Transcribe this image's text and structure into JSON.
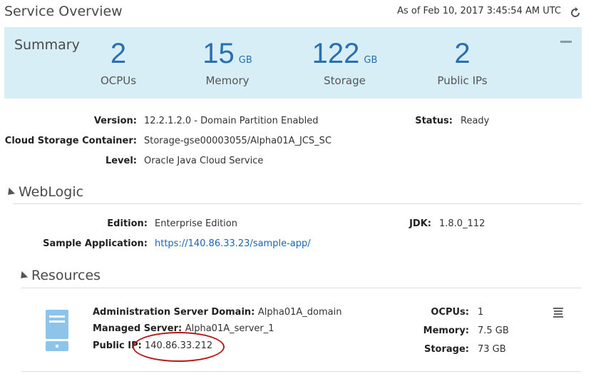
{
  "header": {
    "title": "Service Overview",
    "timestamp": "As of Feb 10, 2017 3:45:54 AM UTC",
    "refresh_icon": "refresh-icon"
  },
  "summary": {
    "title": "Summary",
    "collapse_icon": "minus-icon",
    "ocpus": {
      "value": "2",
      "unit": "",
      "caption": "OCPUs"
    },
    "memory": {
      "value": "15",
      "unit": "GB",
      "caption": "Memory"
    },
    "storage": {
      "value": "122",
      "unit": "GB",
      "caption": "Storage"
    },
    "public_ips": {
      "value": "2",
      "unit": "",
      "caption": "Public IPs"
    }
  },
  "details": {
    "version_label": "Version:",
    "version_value": "12.2.1.2.0 - Domain Partition Enabled",
    "status_label": "Status:",
    "status_value": "Ready",
    "container_label": "Cloud Storage Container:",
    "container_value": "Storage-gse00003055/Alpha01A_JCS_SC",
    "level_label": "Level:",
    "level_value": "Oracle Java Cloud Service"
  },
  "weblogic": {
    "title": "WebLogic",
    "edition_label": "Edition:",
    "edition_value": "Enterprise Edition",
    "jdk_label": "JDK:",
    "jdk_value": "1.8.0_112",
    "sample_label": "Sample Application:",
    "sample_value": "https://140.86.33.23/sample-app/"
  },
  "resources": {
    "title": "Resources",
    "server_icon": "server-icon",
    "menu_icon": "menu-icon",
    "admin_domain_label": "Administration Server Domain:",
    "admin_domain_value": "Alpha01A_domain",
    "managed_server_label": "Managed Server:",
    "managed_server_value": "Alpha01A_server_1",
    "public_ip_label": "Public IP:",
    "public_ip_value": "140.86.33.212",
    "ocpus_label": "OCPUs:",
    "ocpus_value": "1",
    "memory_label": "Memory:",
    "memory_value": "7.5 GB",
    "storage_label": "Storage:",
    "storage_value": "73 GB"
  },
  "colors": {
    "summary_bg": "#d7eef6",
    "accent_blue": "#2a6fb0",
    "link": "#1a66b3",
    "highlight_ellipse": "#b31b1b"
  }
}
